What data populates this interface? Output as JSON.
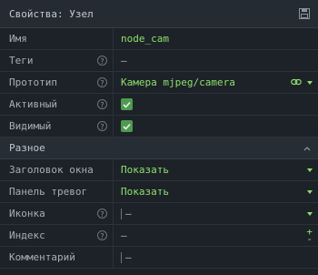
{
  "header": {
    "title": "Свойства: Узел",
    "icon": "save-icon"
  },
  "rows_top": [
    {
      "label": "Имя",
      "value": "node_cam",
      "help": false,
      "type": "text"
    },
    {
      "label": "Теги",
      "value": "—",
      "help": true,
      "type": "plain"
    },
    {
      "label": "Прототип",
      "value": "Камера mjpeg/camera",
      "help": true,
      "type": "select-link"
    },
    {
      "label": "Активный",
      "checked": true,
      "help": true,
      "type": "checkbox"
    },
    {
      "label": "Видимый",
      "checked": true,
      "help": true,
      "type": "checkbox"
    }
  ],
  "section": {
    "label": "Разное",
    "icon": "chevron-up-icon"
  },
  "rows_bottom": [
    {
      "label": "Заголовок окна",
      "value": "Показать",
      "help": false,
      "type": "select"
    },
    {
      "label": "Панель тревог",
      "value": "Показать",
      "help": false,
      "type": "select"
    },
    {
      "label": "Иконка",
      "value": "—",
      "help": true,
      "type": "icon-select"
    },
    {
      "label": "Индекс",
      "value": "—",
      "help": true,
      "type": "stepper",
      "plus": "+",
      "minus": "-"
    },
    {
      "label": "Комментарий",
      "value": "—",
      "help": false,
      "type": "textinput"
    }
  ],
  "help_glyph": "?",
  "colors": {
    "accent": "#8de06b",
    "checkbox": "#4f9a52",
    "background": "#1d2228"
  }
}
